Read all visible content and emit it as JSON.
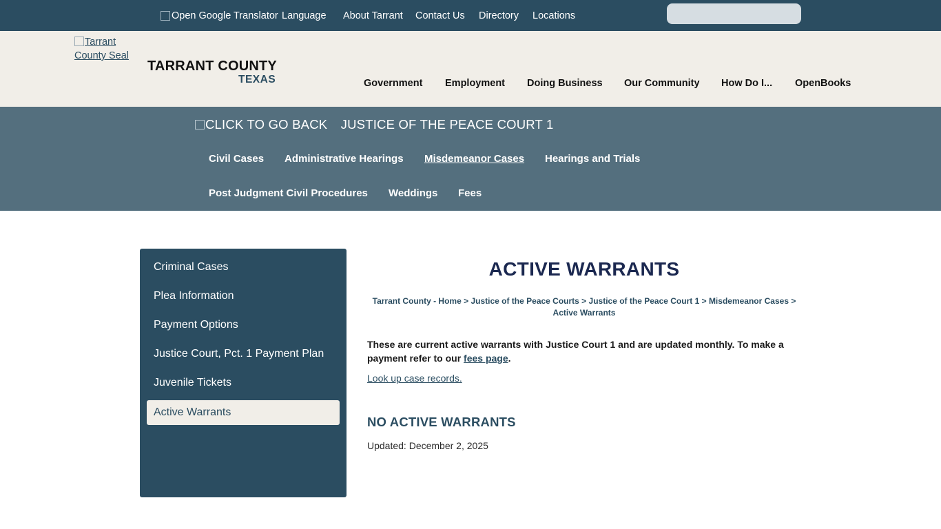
{
  "topbar": {
    "translator_alt": "Open Google Translator",
    "links": [
      "Language",
      "About Tarrant",
      "Contact Us",
      "Directory",
      "Locations"
    ]
  },
  "header": {
    "seal_alt_line1": "Tarrant",
    "seal_alt_line2": "County Seal",
    "brand_name": "TARRANT COUNTY",
    "brand_state": "TEXAS",
    "nav": [
      "Government",
      "Employment",
      "Doing Business",
      "Our Community",
      "How Do I...",
      "OpenBooks"
    ]
  },
  "dept": {
    "back_alt": "Click to go back",
    "title": "JUSTICE OF THE PEACE COURT 1",
    "nav_row1": [
      "Civil Cases",
      "Administrative Hearings",
      "Misdemeanor Cases",
      "Hearings and Trials"
    ],
    "nav_row2": [
      "Post Judgment Civil Procedures",
      "Weddings",
      "Fees"
    ]
  },
  "sidebar": {
    "items": [
      "Criminal Cases",
      "Plea Information",
      "Payment Options",
      "Justice Court, Pct. 1 Payment Plan",
      "Juvenile Tickets",
      "Active Warrants"
    ]
  },
  "content": {
    "title": "ACTIVE WARRANTS",
    "breadcrumbs": [
      "Tarrant County - Home",
      "Justice of the Peace Courts",
      "Justice of the Peace Court 1",
      "Misdemeanor Cases",
      "Active Warrants"
    ],
    "crumb_sep": " > ",
    "intro_text": "These are current active warrants with Justice Court 1 and are updated monthly. To make a payment refer to our ",
    "intro_link": "fees page",
    "intro_end": ".",
    "lookup_link": "Look up case records.",
    "status_heading": "NO ACTIVE WARRANTS",
    "updated": "Updated: December 2, 2025"
  },
  "colors": {
    "topbar": "#2b4d61",
    "header_bg": "#f1eee8",
    "dept_band": "#546f7e",
    "title_navy": "#1b2850"
  }
}
